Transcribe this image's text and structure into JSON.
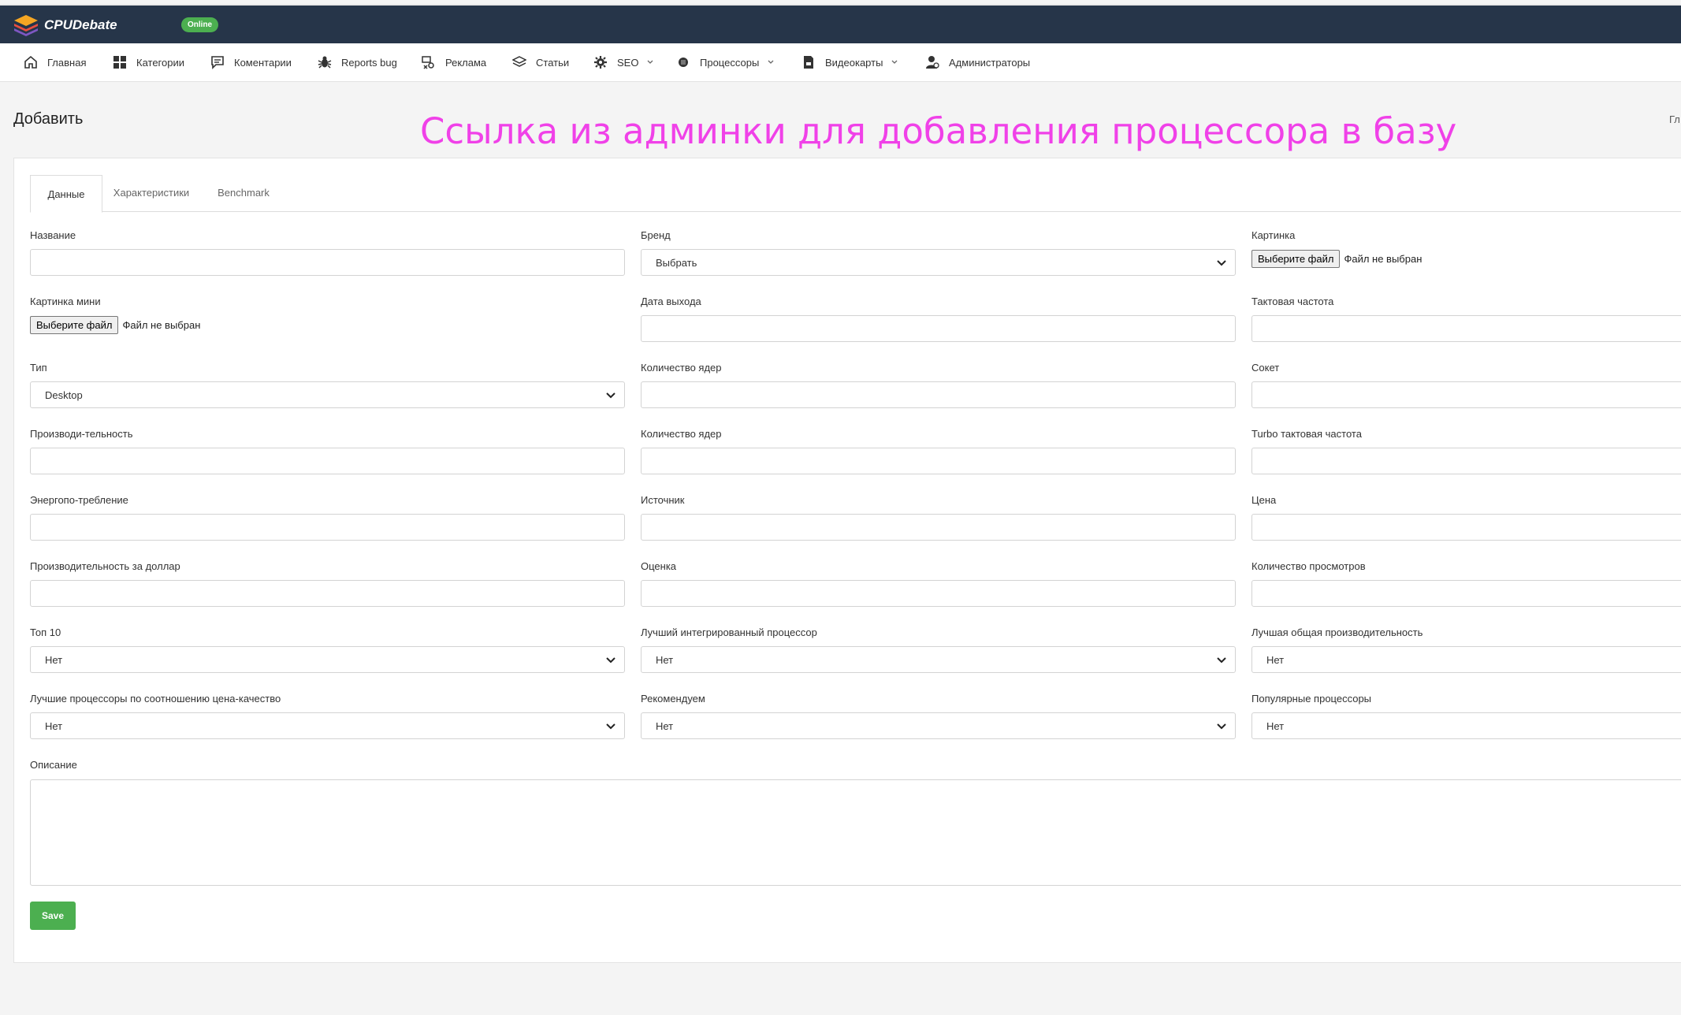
{
  "app": {
    "brand": "CPUDebate",
    "status": "Online"
  },
  "nav": {
    "items": [
      {
        "label": "Главная",
        "icon": "home-icon"
      },
      {
        "label": "Категории",
        "icon": "grid-icon"
      },
      {
        "label": "Коментарии",
        "icon": "comment-icon"
      },
      {
        "label": "Reports bug",
        "icon": "bug-icon"
      },
      {
        "label": "Реклама",
        "icon": "ad-icon"
      },
      {
        "label": "Статьи",
        "icon": "layers-icon"
      },
      {
        "label": "SEO",
        "icon": "gear-icon",
        "dropdown": true
      },
      {
        "label": "Процессоры",
        "icon": "cpu-icon",
        "dropdown": true
      },
      {
        "label": "Видеокарты",
        "icon": "gpu-icon",
        "dropdown": true
      },
      {
        "label": "Администраторы",
        "icon": "admin-icon"
      }
    ]
  },
  "page": {
    "title": "Добавить",
    "annotation": "Ссылка из админки для добавления процессора в базу",
    "breadcrumb_cut": "Гл"
  },
  "tabs": [
    "Данные",
    "Характеристики",
    "Benchmark"
  ],
  "form": {
    "name": {
      "label": "Название",
      "value": ""
    },
    "brand": {
      "label": "Бренд",
      "value": "Выбрать"
    },
    "image": {
      "label": "Картинка",
      "button": "Выберите файл",
      "status": "Файл не выбран"
    },
    "image_mini": {
      "label": "Картинка мини",
      "button": "Выберите файл",
      "status": "Файл не выбран"
    },
    "release_date": {
      "label": "Дата выхода",
      "value": ""
    },
    "clock": {
      "label": "Тактовая частота",
      "value": ""
    },
    "type": {
      "label": "Тип",
      "value": "Desktop"
    },
    "cores": {
      "label": "Количество ядер",
      "value": ""
    },
    "socket": {
      "label": "Сокет",
      "value": ""
    },
    "performance": {
      "label": "Производи-тельность",
      "value": ""
    },
    "cores2": {
      "label": "Количество ядер",
      "value": ""
    },
    "turbo": {
      "label": "Turbo тактовая частота",
      "value": ""
    },
    "power": {
      "label": "Энергопо-требление",
      "value": ""
    },
    "source": {
      "label": "Источник",
      "value": ""
    },
    "price": {
      "label": "Цена",
      "value": ""
    },
    "perf_per_dollar": {
      "label": "Производительность за доллар",
      "value": ""
    },
    "rating": {
      "label": "Оценка",
      "value": ""
    },
    "views": {
      "label": "Количество просмотров",
      "value": ""
    },
    "top10": {
      "label": "Топ 10",
      "value": "Нет"
    },
    "best_integrated": {
      "label": "Лучший интегрированный процессор",
      "value": "Нет"
    },
    "best_overall": {
      "label": "Лучшая общая производительность",
      "value": "Нет"
    },
    "best_value": {
      "label": "Лучшие процессоры по соотношению цена-качество",
      "value": "Нет"
    },
    "recommended": {
      "label": "Рекомендуем",
      "value": "Нет"
    },
    "popular": {
      "label": "Популярные процессоры",
      "value": "Нет"
    },
    "description": {
      "label": "Описание",
      "value": ""
    },
    "save_label": "Save"
  }
}
